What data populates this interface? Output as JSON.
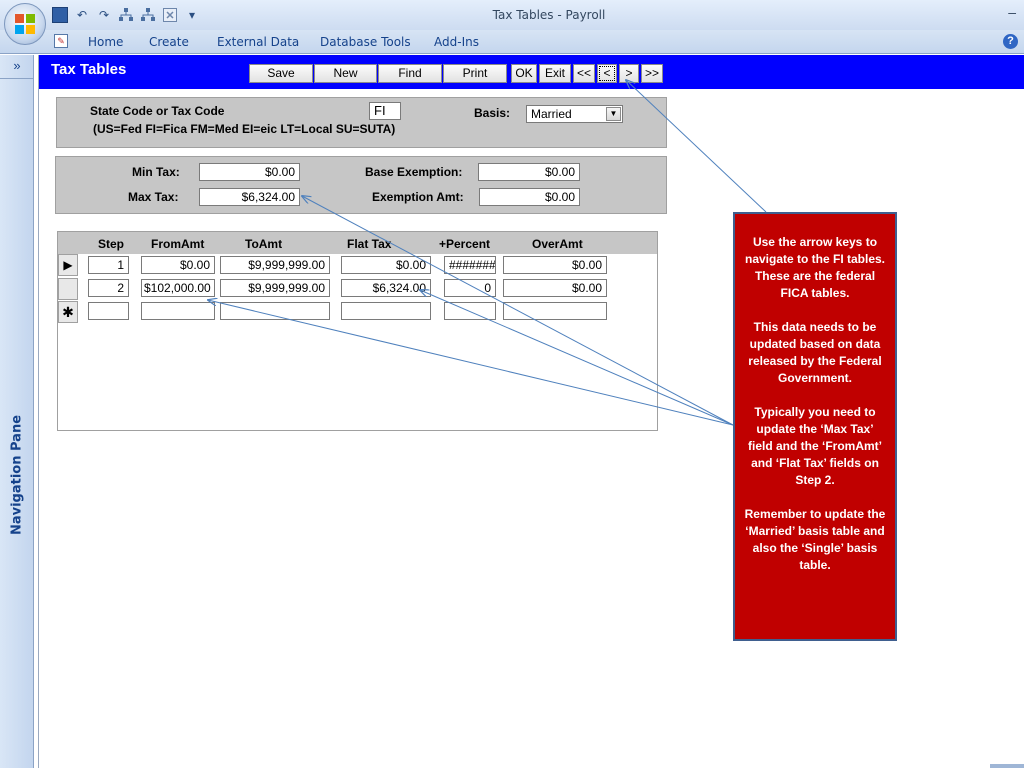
{
  "window": {
    "title": "Tax Tables - Payroll",
    "minimize": "–"
  },
  "quick_access": {
    "undo": "↶",
    "redo": "↷",
    "dropdown": "▾"
  },
  "ribbon": {
    "tabs": [
      "Home",
      "Create",
      "External Data",
      "Database Tools",
      "Add-Ins"
    ],
    "help": "?"
  },
  "nav_pane": {
    "toggle": "»",
    "label": "Navigation Pane"
  },
  "form": {
    "title": "Tax Tables",
    "buttons": [
      "Save",
      "New",
      "Find",
      "Print",
      "OK",
      "Exit",
      "<<",
      "<",
      ">",
      ">>"
    ],
    "state_code_label": "State Code  or Tax Code",
    "state_code_hint": "(US=Fed FI=Fica FM=Med EI=eic LT=Local SU=SUTA)",
    "state_code_value": "FI",
    "basis_label": "Basis:",
    "basis_value": "Married",
    "min_tax_label": "Min Tax:",
    "min_tax_value": "$0.00",
    "max_tax_label": "Max Tax:",
    "max_tax_value": "$6,324.00",
    "base_exemption_label": "Base Exemption:",
    "base_exemption_value": "$0.00",
    "exemption_amt_label": "Exemption Amt:",
    "exemption_amt_value": "$0.00"
  },
  "table": {
    "headers": [
      "Step",
      "FromAmt",
      "ToAmt",
      "Flat Tax",
      "+Percent",
      "OverAmt"
    ],
    "rows": [
      {
        "selector": "▶",
        "step": "1",
        "from": "$0.00",
        "to": "$9,999,999.00",
        "flat": "$0.00",
        "percent": "#######",
        "over": "$0.00"
      },
      {
        "selector": "",
        "step": "2",
        "from": "$102,000.00",
        "to": "$9,999,999.00",
        "flat": "$6,324.00",
        "percent": "0",
        "over": "$0.00"
      }
    ],
    "new_row_selector": "✱"
  },
  "callout": {
    "paragraphs": [
      "Use the arrow keys to navigate to the FI tables. These are the federal FICA tables.",
      "This data needs to be updated based on data released by the Federal Government.",
      "Typically you need to update the ‘Max Tax’ field and the ‘FromAmt’ and ‘Flat Tax’ fields on Step 2.",
      "Remember to update the ‘Married’ basis table and also the ‘Single’ basis table."
    ]
  },
  "colors": {
    "header_blue": "#0000ff",
    "callout_red": "#c00000",
    "section_gray": "#c6c6c6"
  }
}
